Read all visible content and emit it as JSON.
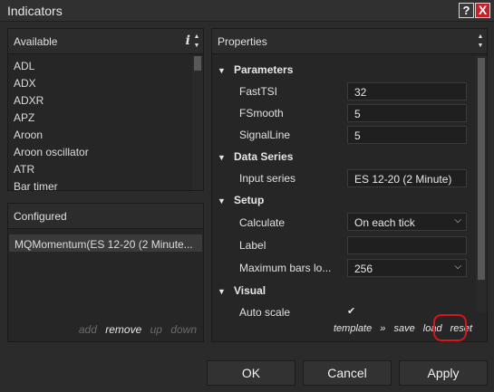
{
  "window": {
    "title": "Indicators",
    "help_label": "?",
    "close_label": "X"
  },
  "available": {
    "title": "Available",
    "items": [
      "ADL",
      "ADX",
      "ADXR",
      "APZ",
      "Aroon",
      "Aroon oscillator",
      "ATR",
      "Bar timer"
    ]
  },
  "configured": {
    "title": "Configured",
    "items": [
      "MQMomentum(ES 12-20 (2 Minute..."
    ],
    "actions": {
      "add": "add",
      "remove": "remove",
      "up": "up",
      "down": "down"
    }
  },
  "properties": {
    "title": "Properties",
    "sections": {
      "parameters": "Parameters",
      "data_series": "Data Series",
      "setup": "Setup",
      "visual": "Visual"
    },
    "fields": {
      "fast_tsi": {
        "label": "FastTSI",
        "value": "32"
      },
      "fsmooth": {
        "label": "FSmooth",
        "value": "5"
      },
      "signal_line": {
        "label": "SignalLine",
        "value": "5"
      },
      "input_series": {
        "label": "Input series",
        "value": "ES 12-20 (2 Minute)"
      },
      "calculate": {
        "label": "Calculate",
        "value": "On each tick"
      },
      "label": {
        "label": "Label",
        "value": ""
      },
      "max_bars": {
        "label": "Maximum bars lo...",
        "value": "256"
      },
      "auto_scale": {
        "label": "Auto scale",
        "checked": true
      }
    },
    "footer": {
      "template": "template",
      "sep": "»",
      "save": "save",
      "load": "load",
      "reset": "reset"
    }
  },
  "buttons": {
    "ok": "OK",
    "cancel": "Cancel",
    "apply": "Apply"
  },
  "colors": {
    "highlight_circle": "#d8151c",
    "close_button": "#c8202a"
  }
}
